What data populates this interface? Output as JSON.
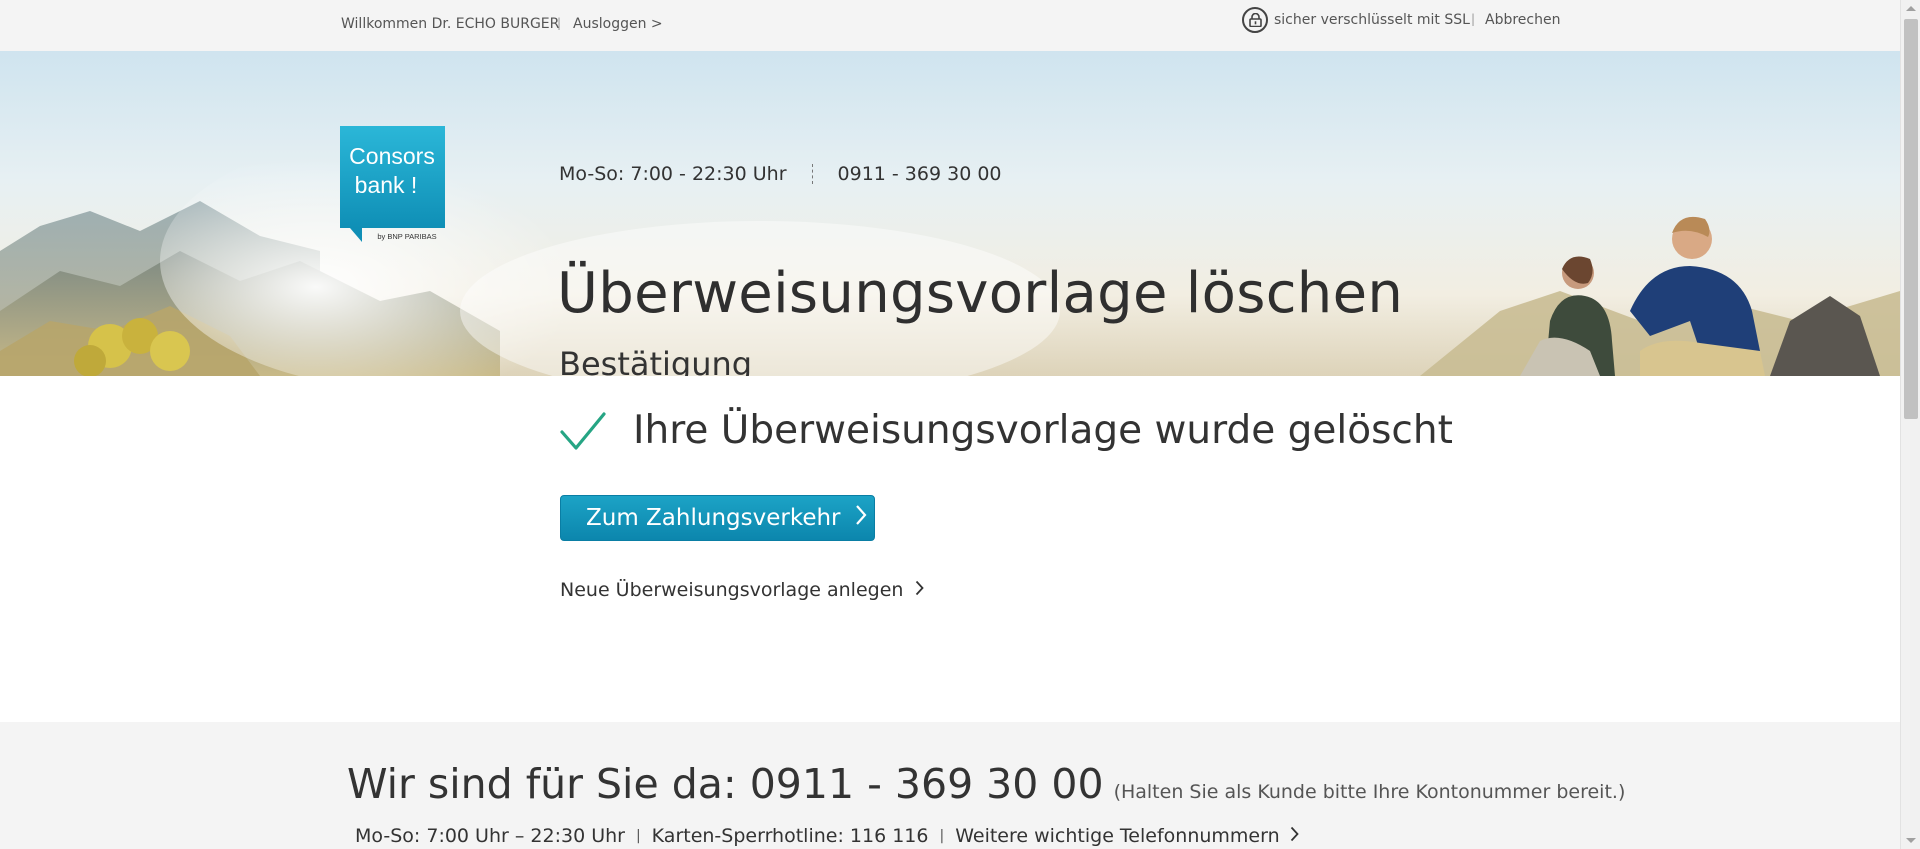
{
  "topbar": {
    "welcome": "Willkommen Dr. ECHO BURGER",
    "separator": "|",
    "logout": "Ausloggen >",
    "ssl_text": "sicher verschlüsselt mit SSL",
    "cancel": "Abbrechen"
  },
  "logo": {
    "line1": "Consors",
    "line2": "bank !",
    "tagline": "by BNP PARIBAS",
    "brand_color": "#1aa3c6"
  },
  "hero": {
    "hours": "Mo-So: 7:00 - 22:30 Uhr",
    "phone": "0911 - 369 30 00",
    "title": "Überweisungsvorlage löschen",
    "subtitle": "Bestätigung"
  },
  "main": {
    "success_message": "Ihre Überweisungsvorlage wurde gelöscht",
    "success_color": "#26a584",
    "primary_button": "Zum Zahlungsverkehr",
    "secondary_link": "Neue Überweisungsvorlage anlegen"
  },
  "footer": {
    "heading": "Wir sind für Sie da: 0911 - 369 30 00",
    "heading_note": "(Halten Sie als Kunde bitte Ihre Kontonummer bereit.)",
    "hours": "Mo-So: 7:00 Uhr – 22:30 Uhr",
    "separator": "|",
    "card_hotline": "Karten-Sperrhotline: 116 116",
    "more_numbers": "Weitere wichtige Telefonnummern"
  },
  "icons": [
    "lock-icon",
    "check-icon",
    "chevron-right-icon"
  ]
}
